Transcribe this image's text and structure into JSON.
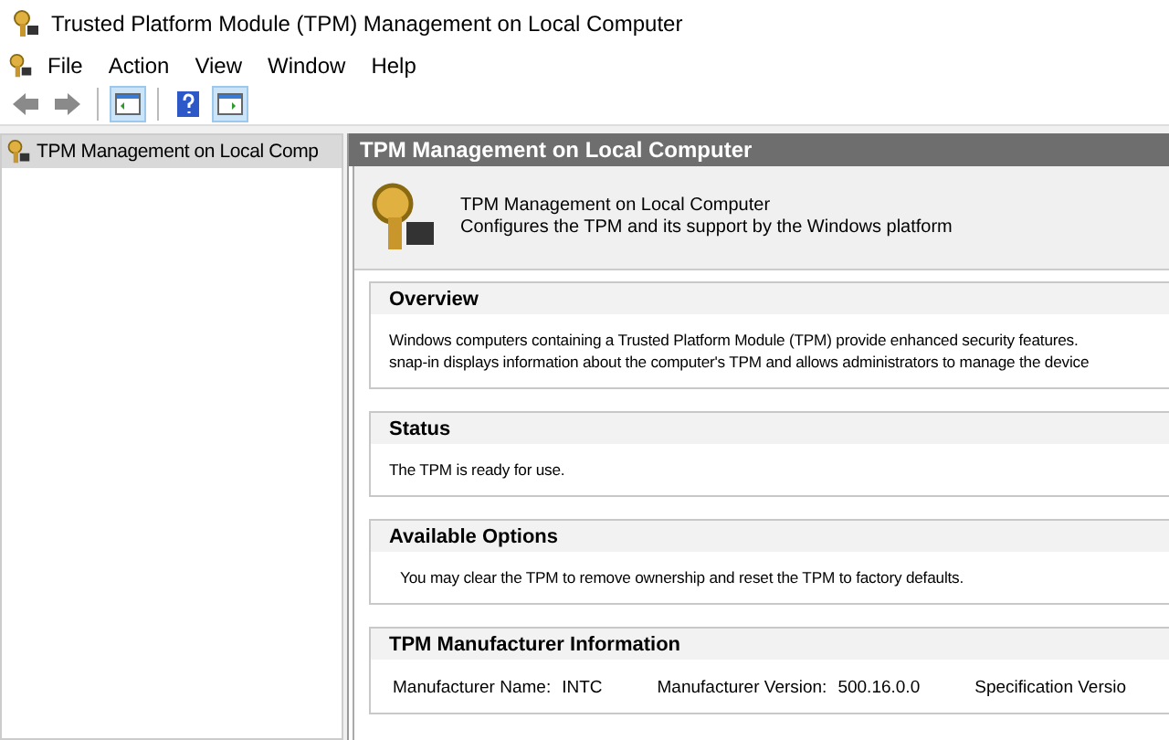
{
  "window": {
    "title": "Trusted Platform Module (TPM) Management on Local Computer"
  },
  "menu": [
    "File",
    "Action",
    "View",
    "Window",
    "Help"
  ],
  "toolbar": [
    {
      "kind": "back"
    },
    {
      "kind": "forward"
    },
    {
      "kind": "separator"
    },
    {
      "kind": "pane",
      "on": true
    },
    {
      "kind": "separator"
    },
    {
      "kind": "help"
    },
    {
      "kind": "action-pane",
      "on": true
    }
  ],
  "tree": [
    {
      "label": "TPM Management on Local Comp",
      "selected": true
    }
  ],
  "header": "TPM Management on Local Computer",
  "info": {
    "title": "TPM Management on Local Computer",
    "subtitle": "Configures the TPM and its support by the Windows platform"
  },
  "sections": [
    {
      "title": "Overview",
      "lines": [
        "Windows computers containing a Trusted Platform Module (TPM) provide enhanced security features.",
        "snap-in displays information about the computer's TPM and allows administrators to manage the device"
      ],
      "indent": false
    },
    {
      "title": "Status",
      "lines": [
        "The TPM is ready for use."
      ],
      "indent": false
    },
    {
      "title": "Available Options",
      "lines": [
        "You may clear the TPM to remove ownership and reset the TPM to factory defaults."
      ],
      "indent": true
    },
    {
      "title": "TPM Manufacturer Information",
      "fields": [
        {
          "label": "Manufacturer Name:",
          "value": "INTC"
        },
        {
          "label": "Manufacturer Version:",
          "value": "500.16.0.0"
        },
        {
          "label": "Specification Versio"
        }
      ]
    }
  ]
}
